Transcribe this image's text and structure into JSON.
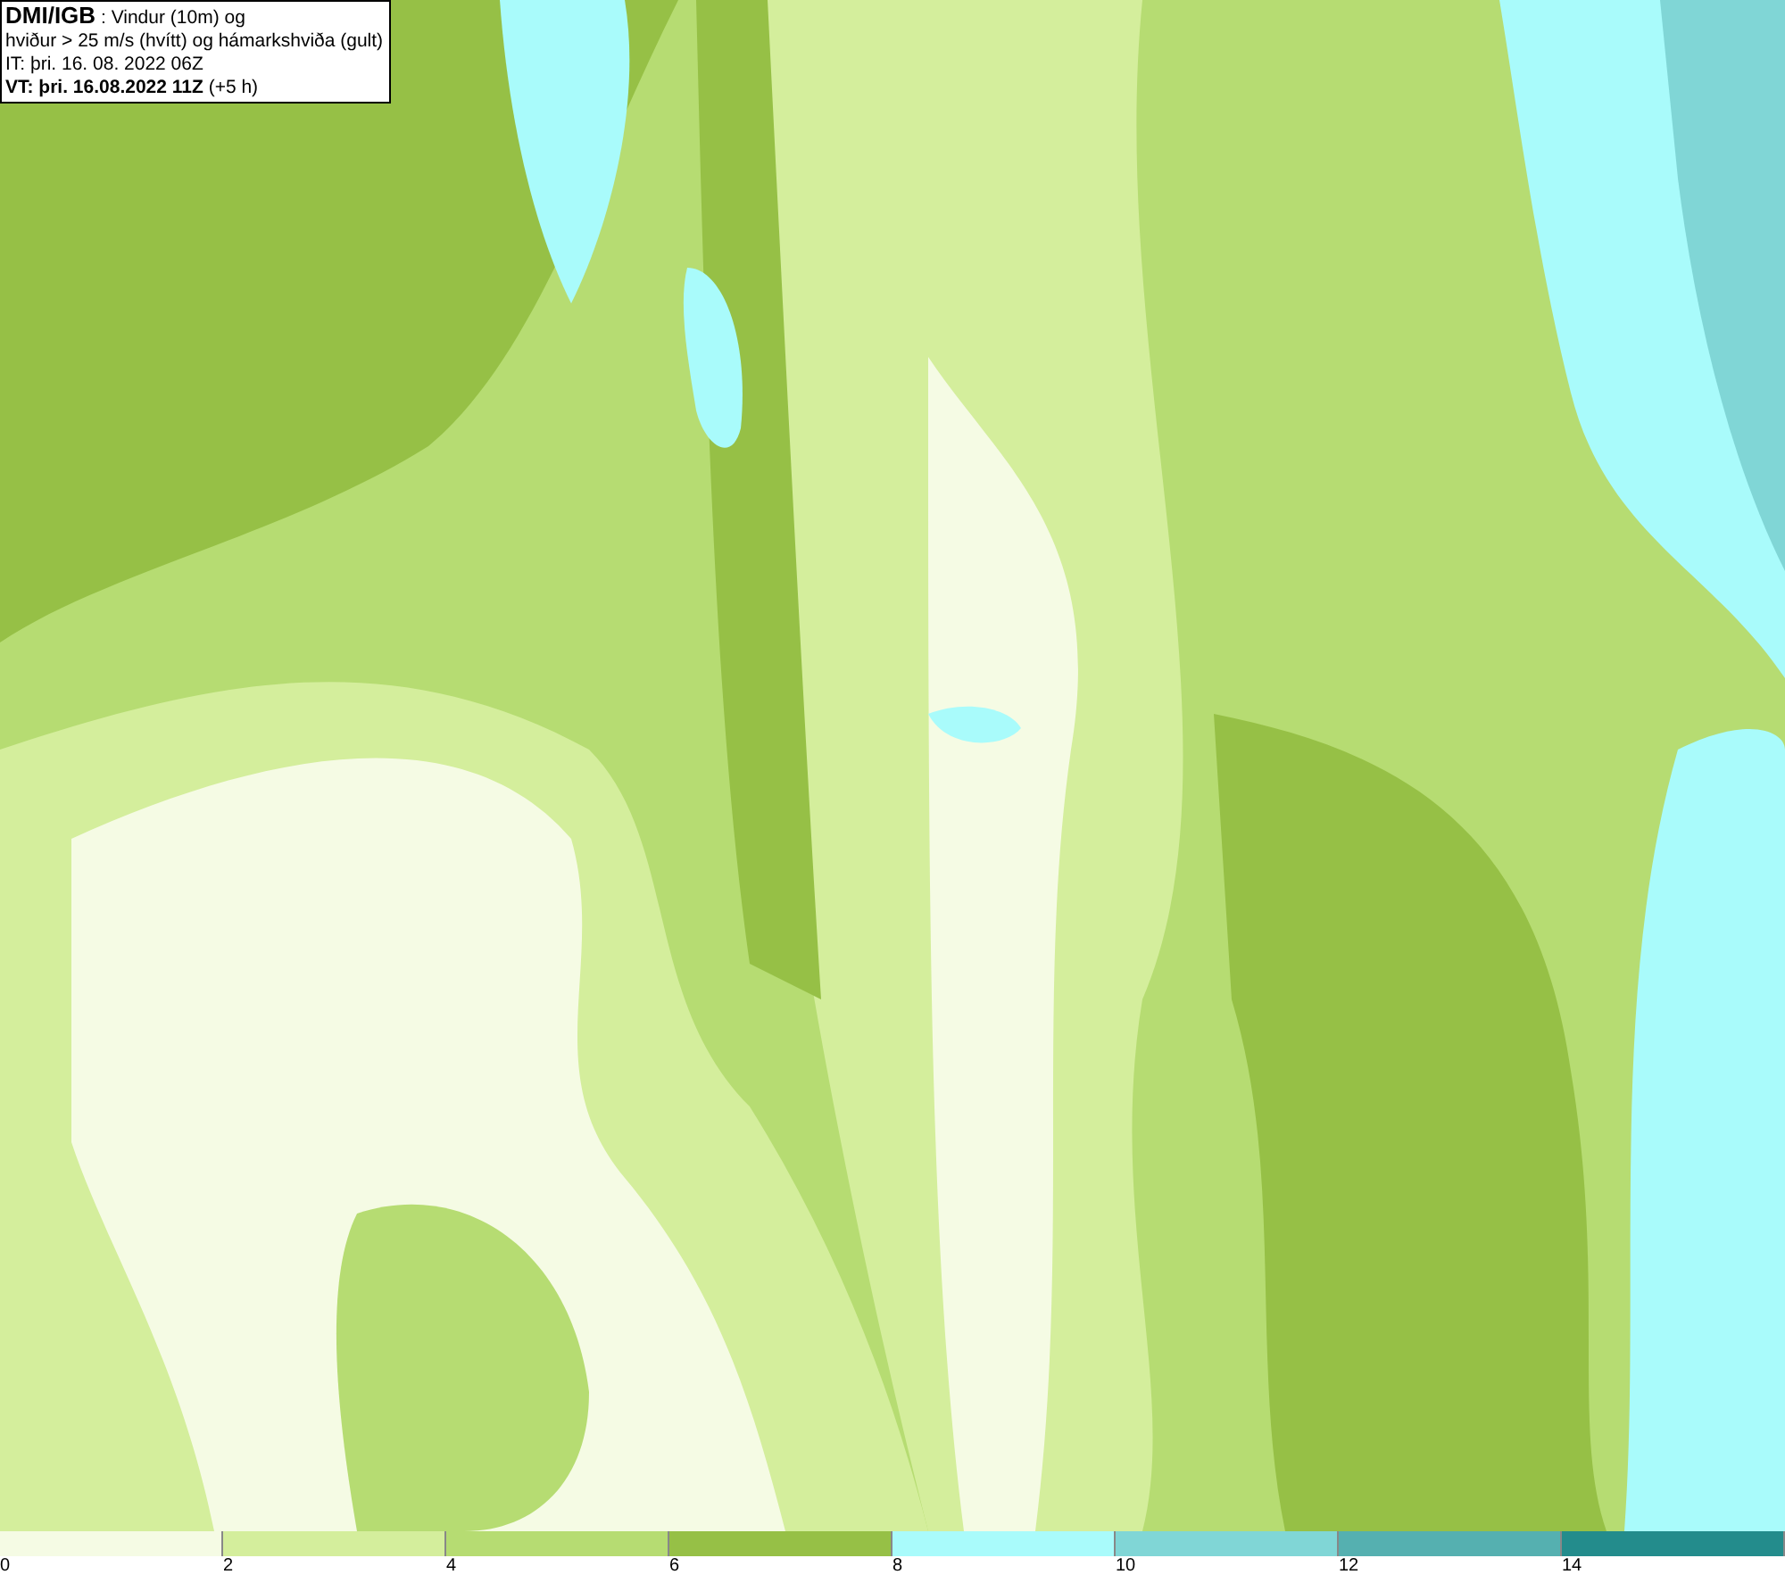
{
  "title_box": {
    "lines": [
      "**DMI/IGB** : Vindur (10m) og",
      "hviður > 25 m/s (hvítt) og hámarkshviða (gult)",
      "IT: þri. 16. 08. 2022 06Z",
      "**VT: þri. 16.08.2022 11Z** (+5 h)"
    ]
  },
  "legend": {
    "bins": [
      {
        "color": "#f5fbe4",
        "tick": "0"
      },
      {
        "color": "#d4ee9c",
        "tick": "2"
      },
      {
        "color": "#b6dc72",
        "tick": "4"
      },
      {
        "color": "#96c046",
        "tick": "6"
      },
      {
        "color": "#a9fbfb",
        "tick": "8"
      },
      {
        "color": "#80d6d6",
        "tick": "10"
      },
      {
        "color": "#55b0b0",
        "tick": "12"
      },
      {
        "color": "#238c8c",
        "tick": "14"
      }
    ]
  }
}
